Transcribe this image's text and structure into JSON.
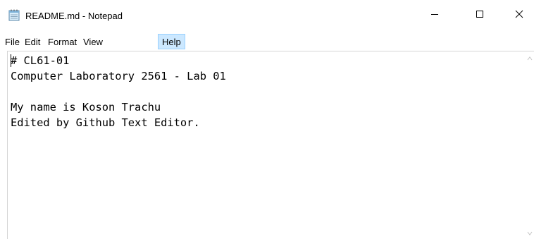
{
  "window": {
    "title": "README.md - Notepad"
  },
  "menu": {
    "items": [
      {
        "label": "File"
      },
      {
        "label": "Edit"
      },
      {
        "label": "Format"
      },
      {
        "label": "View"
      },
      {
        "label": "Help"
      }
    ],
    "active": "Help",
    "active_color": "#cce8ff"
  },
  "editor": {
    "lines": [
      "# CL61-01",
      "Computer Laboratory 2561 - Lab 01",
      "",
      "My name is Koson Trachu",
      "Edited by Github Text Editor."
    ]
  },
  "icons": {
    "app": "notepad-icon",
    "minimize": "minimize-icon",
    "maximize": "maximize-icon",
    "close": "close-icon"
  }
}
